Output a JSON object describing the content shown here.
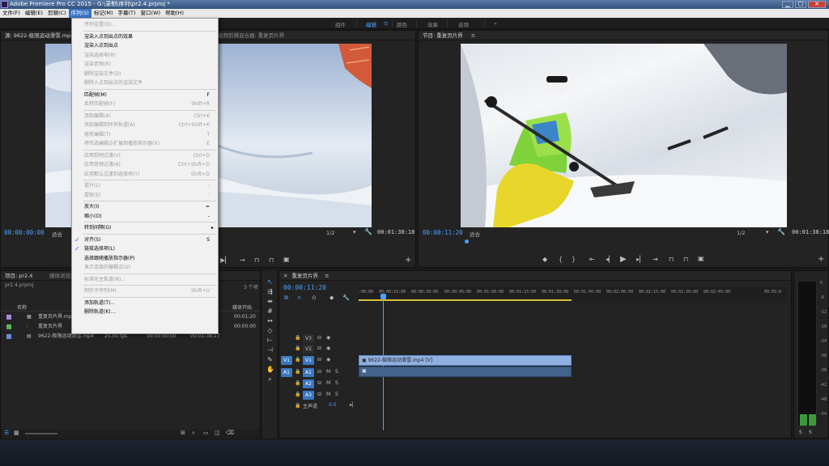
{
  "app": {
    "title": "Adobe Premiere Pro CC 2015 - G:\\录制\\序列\\pr2.4.prproj *",
    "window_buttons": [
      "▁",
      "□",
      "✕"
    ]
  },
  "menubar": [
    "文件(F)",
    "编辑(E)",
    "剪辑(C)",
    "序列(S)",
    "标记(M)",
    "字幕(T)",
    "窗口(W)",
    "帮助(H)"
  ],
  "workspaces": {
    "items": [
      "组件",
      "编辑",
      "颜色",
      "效果",
      "音频"
    ],
    "active": "编辑",
    "more": "»"
  },
  "sequence_menu": {
    "items": [
      {
        "label": "序列设置(Q)...",
        "enabled": false
      },
      {
        "sep": true
      },
      {
        "label": "渲染入点到出点的效果",
        "enabled": true
      },
      {
        "label": "渲染入点到出点",
        "enabled": true
      },
      {
        "label": "渲染选择项(R)",
        "enabled": false
      },
      {
        "label": "渲染音频(R)",
        "enabled": false
      },
      {
        "label": "删除渲染文件(D)",
        "enabled": false
      },
      {
        "label": "删除入点到出点的渲染文件",
        "enabled": false
      },
      {
        "sep": true
      },
      {
        "label": "匹配帧(M)",
        "shortcut": "F",
        "enabled": true
      },
      {
        "label": "反转匹配帧(F)",
        "shortcut": "Shift+R",
        "enabled": false
      },
      {
        "sep": true
      },
      {
        "label": "添加编辑(A)",
        "shortcut": "Ctrl+K",
        "enabled": false
      },
      {
        "label": "添加编辑到所有轨道(A)",
        "shortcut": "Ctrl+Shift+K",
        "enabled": false
      },
      {
        "label": "修剪编辑(T)",
        "shortcut": "T",
        "enabled": false
      },
      {
        "label": "将所选编辑点扩展到播放指示器(X)",
        "shortcut": "E",
        "enabled": false
      },
      {
        "sep": true
      },
      {
        "label": "应用视频过渡(V)",
        "shortcut": "Ctrl+D",
        "enabled": false
      },
      {
        "label": "应用音频过渡(A)",
        "shortcut": "Ctrl+Shift+D",
        "enabled": false
      },
      {
        "label": "应用默认过渡到选择项(Y)",
        "shortcut": "Shift+D",
        "enabled": false
      },
      {
        "sep": true
      },
      {
        "label": "提升(L)",
        "shortcut": ";",
        "enabled": false
      },
      {
        "label": "提取(E)",
        "shortcut": "'",
        "enabled": false
      },
      {
        "sep": true
      },
      {
        "label": "放大(I)",
        "shortcut": "=",
        "enabled": true
      },
      {
        "label": "缩小(O)",
        "shortcut": "-",
        "enabled": true
      },
      {
        "sep": true
      },
      {
        "label": "转到间隔(G)",
        "submenu": true,
        "enabled": true
      },
      {
        "sep": true
      },
      {
        "label": "对齐(S)",
        "shortcut": "S",
        "checked": true,
        "enabled": true
      },
      {
        "label": "链接选择项(L)",
        "checked": true,
        "enabled": true
      },
      {
        "label": "选择跟随播放指示器(P)",
        "enabled": true
      },
      {
        "label": "显示连接的编辑点(U)",
        "enabled": false
      },
      {
        "sep": true
      },
      {
        "label": "标准化主轨道(N)...",
        "enabled": false
      },
      {
        "sep": true
      },
      {
        "label": "制作子序列(M)",
        "shortcut": "Shift+U",
        "enabled": false
      },
      {
        "sep": true
      },
      {
        "label": "添加轨道(T)...",
        "enabled": true
      },
      {
        "label": "删除轨道(K)...",
        "enabled": true
      }
    ]
  },
  "source": {
    "tab": "源: 9622-极限运动滑雪.mp4",
    "tab2": "音频剪辑混合器: 重复页片界",
    "timecode": "00:00:00:00",
    "fit": "适合",
    "zoom": "1/2",
    "duration": "00:01:38:18"
  },
  "program": {
    "tab": "节目: 重复页片界",
    "timecode": "00:00:11:20",
    "fit": "适合",
    "zoom": "1/2",
    "duration": "00:01:38:18"
  },
  "project": {
    "tab": "项目: pr2.4",
    "tab2": "媒体浏览器",
    "file": "pr2.4.prproj",
    "count": "3 个项",
    "col_name": "名称",
    "col_start": "媒体开始",
    "rows": [
      {
        "name": "重复页片界.mp4",
        "start": "00:01:20",
        "color": "#a88ad8"
      },
      {
        "name": "重复页片界",
        "start": "00:00:00",
        "color": "#5bb55b"
      },
      {
        "name": "9622-极限运动滑雪.mp4",
        "fps": "25.00 fps",
        "start": "00:00:00:00",
        "end": "00:01:38:17",
        "color": "#6e8fd6"
      }
    ]
  },
  "timeline": {
    "tab": "重复页片界",
    "timecode": "00:00:11:20",
    "ruler": [
      ":00:00",
      "00:00:15:00",
      "00:00:30:00",
      "00:00:45:00",
      "00:01:00:00",
      "00:01:15:00",
      "00:01:30:00",
      "00:01:45:00",
      "00:02:00:00",
      "00:02:15:00",
      "00:02:30:00",
      "00:02:45:00",
      "00:03:0"
    ],
    "video_tracks": [
      "V3",
      "V2",
      "V1"
    ],
    "audio_tracks": [
      "A1",
      "A2",
      "A3"
    ],
    "src_v": "V1",
    "src_a": "A1",
    "clip_label": "9622-极限运动滑雪.mp4 [V]",
    "master_label": "主声道",
    "master_value": "0.0",
    "track_m": "M",
    "track_s": "S"
  },
  "meter": {
    "labels": [
      "S",
      "S"
    ],
    "db": [
      "0",
      "-6",
      "-12",
      "-18",
      "-24",
      "-30",
      "-36",
      "-42",
      "-48",
      "-54"
    ]
  }
}
